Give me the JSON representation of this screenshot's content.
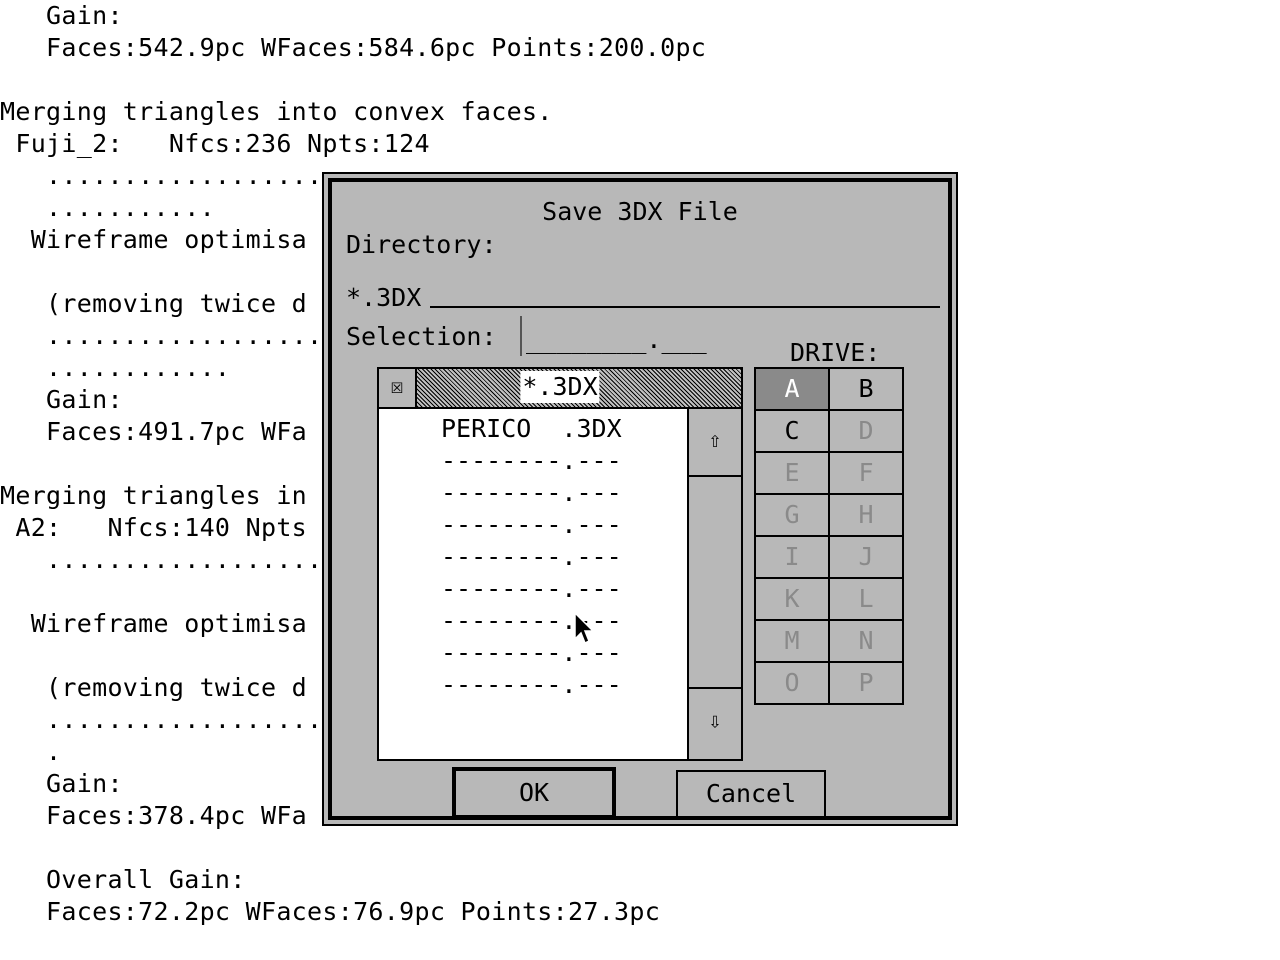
{
  "console": {
    "lines": [
      "   Gain:",
      "   Faces:542.9pc WFaces:584.6pc Points:200.0pc",
      "",
      "Merging triangles into convex faces.",
      " Fuji_2:   Nfcs:236 Npts:124",
      "   ..................",
      "   ...........",
      "  Wireframe optimisa",
      "",
      "   (removing twice d",
      "   ..................",
      "   ............",
      "   Gain:",
      "   Faces:491.7pc WFa",
      "",
      "Merging triangles in",
      " A2:   Nfcs:140 Npts",
      "   ..................",
      "",
      "  Wireframe optimisa",
      "",
      "   (removing twice d",
      "   ..................",
      "   .",
      "   Gain:",
      "   Faces:378.4pc WFa",
      "",
      "   Overall Gain:",
      "   Faces:72.2pc WFaces:76.9pc Points:27.3pc"
    ]
  },
  "dialog": {
    "title": "Save 3DX File",
    "directory_label": "Directory:",
    "directory_value": "*.3DX",
    "selection_label": "Selection:",
    "selection_value": "________.___",
    "drive_label": "DRIVE:",
    "list_filter": "*.3DX",
    "close_icon": "☒",
    "scroll_up_icon": "⇧",
    "scroll_down_icon": "⇩",
    "files": [
      "PERICO  .3DX",
      "--------.---",
      "--------.---",
      "--------.---",
      "--------.---",
      "--------.---",
      "--------.---",
      "--------.---",
      "--------.---"
    ],
    "drives": [
      {
        "letter": "A",
        "state": "selected"
      },
      {
        "letter": "B",
        "state": "enabled"
      },
      {
        "letter": "C",
        "state": "enabled"
      },
      {
        "letter": "D",
        "state": "disabled"
      },
      {
        "letter": "E",
        "state": "disabled"
      },
      {
        "letter": "F",
        "state": "disabled"
      },
      {
        "letter": "G",
        "state": "disabled"
      },
      {
        "letter": "H",
        "state": "disabled"
      },
      {
        "letter": "I",
        "state": "disabled"
      },
      {
        "letter": "J",
        "state": "disabled"
      },
      {
        "letter": "K",
        "state": "disabled"
      },
      {
        "letter": "L",
        "state": "disabled"
      },
      {
        "letter": "M",
        "state": "disabled"
      },
      {
        "letter": "N",
        "state": "disabled"
      },
      {
        "letter": "O",
        "state": "disabled"
      },
      {
        "letter": "P",
        "state": "disabled"
      }
    ],
    "ok_label": "OK",
    "cancel_label": "Cancel"
  },
  "colors": {
    "dialog_bg": "#b8b8b8",
    "selected_drive": "#8a8a8a"
  }
}
